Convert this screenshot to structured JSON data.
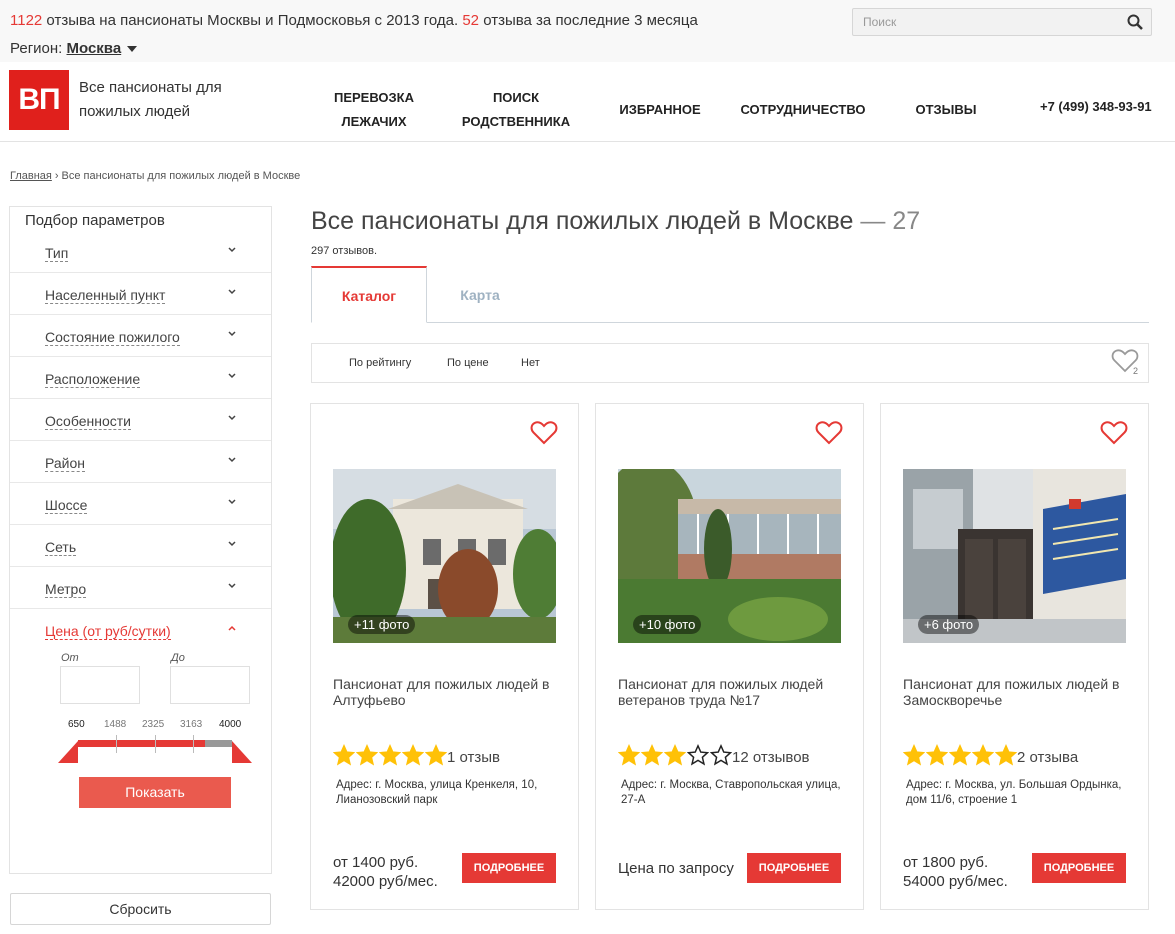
{
  "topbar": {
    "reviews_total": "1122",
    "reviews_text_1": " отзыва на пансионаты Москвы и Подмосковья с 2013 года. ",
    "reviews_recent": "52",
    "reviews_text_2": " отзыва за последние 3 месяца",
    "region_label": "Регион: ",
    "region_value": "Москва",
    "search_placeholder": "Поиск"
  },
  "header": {
    "logo": "ВП",
    "site_name": "Все пансионаты для пожилых людей",
    "nav": [
      {
        "line1": "Перевозка",
        "line2": "лежачих"
      },
      {
        "line1": "Поиск",
        "line2": "родственника"
      },
      {
        "line1": "Избранное",
        "line2": ""
      },
      {
        "line1": "Сотрудничество",
        "line2": ""
      },
      {
        "line1": "Отзывы",
        "line2": ""
      }
    ],
    "phone": "+7 (499) 348-93-91"
  },
  "breadcrumb": {
    "home": "Главная",
    "separator": "›",
    "current": "Все пансионаты для пожилых людей в Москве"
  },
  "sidebar": {
    "heading": "Подбор параметров",
    "filters": [
      "Тип",
      "Населенный пункт",
      "Состояние пожилого",
      "Расположение",
      "Особенности",
      "Район",
      "Шоссе",
      "Сеть",
      "Метро"
    ],
    "price_filter": "Цена (от руб/сутки)",
    "from_label": "От",
    "to_label": "До",
    "ticks": [
      "650",
      "1488",
      "2325",
      "3163",
      "4000"
    ],
    "show_button": "Показать",
    "reset_button": "Сбросить"
  },
  "main": {
    "title": "Все пансионаты для пожилых людей в Москве",
    "count": "— 27",
    "reviews_count": "297 отзывов.",
    "tabs": [
      "Каталог",
      "Карта"
    ],
    "sort": [
      "По рейтингу",
      "По цене",
      "Нет"
    ],
    "favorites_count": "2"
  },
  "cards": [
    {
      "photos": "+11 фото",
      "name": "Пансионат для пожилых людей в Алтуфьево",
      "rating": 5,
      "reviews": "1 отзыв",
      "address": "Адрес: г. Москва, улица Кренкеля, 10, Лианозовский парк",
      "price_line1": "от 1400 руб.",
      "price_line2": "42000 руб/мес.",
      "button": "ПОДРОБНЕЕ"
    },
    {
      "photos": "+10 фото",
      "name": "Пансионат для пожилых людей ветеранов труда №17",
      "rating": 3,
      "reviews": "12 отзывов",
      "address": "Адрес: г. Москва, Ставропольская улица, 27-А",
      "price_line1": "Цена по запросу",
      "price_line2": "",
      "button": "ПОДРОБНЕЕ"
    },
    {
      "photos": "+6 фото",
      "name": "Пансионат для пожилых людей в Замоскворечье",
      "rating": 5,
      "reviews": "2 отзыва",
      "address": "Адрес: г. Москва, ул. Большая Ордынка, дом 11/6, строение 1",
      "price_line1": "от 1800 руб.",
      "price_line2": "54000 руб/мес.",
      "button": "ПОДРОБНЕЕ"
    }
  ],
  "colors": {
    "accent": "#e53935",
    "star": "#ffc107",
    "tab_inactive": "#9fb2c2"
  }
}
